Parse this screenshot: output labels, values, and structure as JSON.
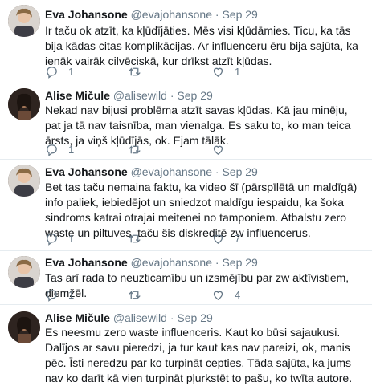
{
  "tweets": [
    {
      "name": "Eva Johansone",
      "handle": "@evajohansone",
      "sep": "·",
      "date": "Sep 29",
      "text": "Ir taču ok atzīt, ka kļūdījāties. Mēs visi kļūdāmies. Ticu, ka tās bija kādas citas komplikācijas. Ar influenceru ēru bija sajūta, ka ienāk vairāk cilvēciskā, kur drīkst atzīt kļūdas.",
      "replies": "1",
      "retweets": "",
      "likes": "1"
    },
    {
      "name": "Alise Mičule",
      "handle": "@alisewild",
      "sep": "·",
      "date": "Sep 29",
      "text": "Nekad nav bijusi problēma atzīt savas kļūdas. Kā jau minēju, pat ja tā nav taisnība, man vienalga. Es saku to, ko man teica ārsts, ja viņš kļūdījās, ok. Ejam tālāk.",
      "replies": "1",
      "retweets": "",
      "likes": ""
    },
    {
      "name": "Eva Johansone",
      "handle": "@evajohansone",
      "sep": "·",
      "date": "Sep 29",
      "text": "Bet tas taču nemaina faktu, ka video šī (pārspīlētā un maldīgā) info paliek, iebiedējot un sniedzot maldīgu iespaidu, ka šoka sindroms katrai otrajai meitenei no tamponiem. Atbalstu zero waste un piltuves, taču šis diskreditē zw influencerus.",
      "replies": "1",
      "retweets": "",
      "likes": "7"
    },
    {
      "name": "Eva Johansone",
      "handle": "@evajohansone",
      "sep": "·",
      "date": "Sep 29",
      "text": "Tas arī rada to neuzticamību un izsmējību par zw aktīvistiem, diemžēl.",
      "replies": "1",
      "retweets": "",
      "likes": "4"
    },
    {
      "name": "Alise Mičule",
      "handle": "@alisewild",
      "sep": "·",
      "date": "Sep 29",
      "text": "Es neesmu zero waste influenceris. Kaut ko būsi sajaukusi. Dalījos ar savu pieredzi, ja tur kaut kas nav pareizi, ok, manis pēc. Īsti neredzu par ko turpināt cepties. Tāda sajūta, ka jums nav ko darīt kā vien turpināt pļurkstēt to pašu, ko twīta autore.",
      "replies": "",
      "retweets": "",
      "likes": ""
    }
  ],
  "icons": {
    "reply": "reply-icon",
    "retweet": "retweet-icon",
    "like": "heart-icon"
  },
  "colors": {
    "text": "#14171a",
    "secondary": "#657786",
    "divider": "#e6ecf0"
  }
}
